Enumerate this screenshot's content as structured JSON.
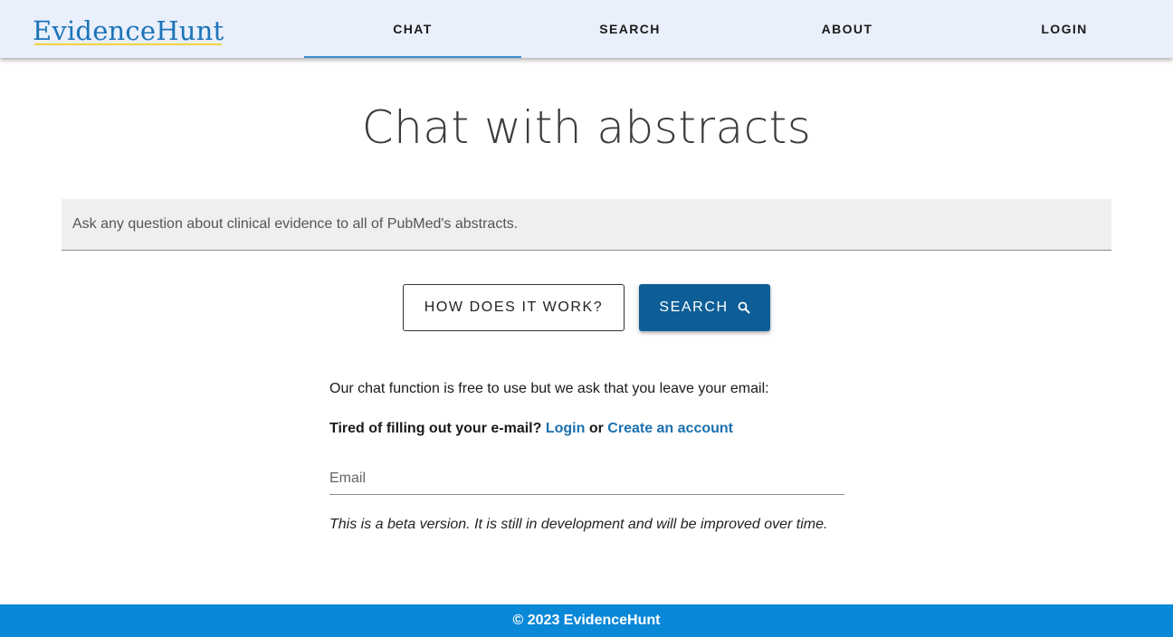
{
  "header": {
    "logo_text": "EvidenceHunt",
    "nav": [
      {
        "label": "CHAT",
        "active": true
      },
      {
        "label": "SEARCH",
        "active": false
      },
      {
        "label": "ABOUT",
        "active": false
      },
      {
        "label": "LOGIN",
        "active": false
      }
    ]
  },
  "main": {
    "title": "Chat with abstracts",
    "question_input": {
      "placeholder": "Ask any question about clinical evidence to all of PubMed's abstracts.",
      "value": ""
    },
    "how_button_label": "HOW DOES IT WORK?",
    "search_button_label": "SEARCH",
    "search_button_icon": "search-icon",
    "info_text": "Our chat function is free to use but we ask that you leave your email:",
    "login_prompt": {
      "text": "Tired of filling out your e-mail?",
      "login_link": "Login",
      "or": "or",
      "create_link": "Create an account"
    },
    "email_input": {
      "placeholder": "Email",
      "value": ""
    },
    "beta_note": "This is a beta version. It is still in development and will be improved over time."
  },
  "footer": {
    "copyright": "© 2023 EvidenceHunt"
  },
  "colors": {
    "header_bg": "#e9effb",
    "brand_blue": "#1b74b8",
    "primary_button": "#0d5e96",
    "link": "#1a70ad",
    "footer_bg": "#0a88d8"
  }
}
